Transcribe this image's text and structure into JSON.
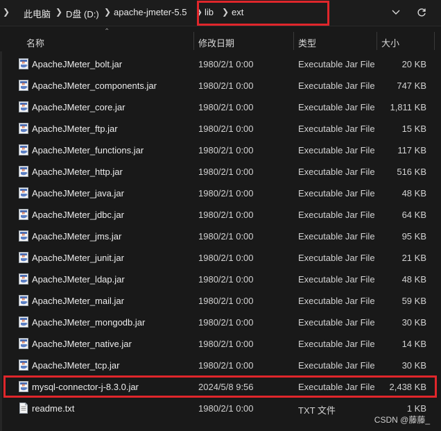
{
  "address": {
    "crumbs": [
      "此电脑",
      "D盘 (D:)",
      "apache-jmeter-5.5",
      "lib",
      "ext"
    ],
    "chevron_icon": "chevron-down-icon",
    "refresh_icon": "refresh-icon"
  },
  "columns": {
    "name": "名称",
    "date": "修改日期",
    "type": "类型",
    "size": "大小"
  },
  "files": [
    {
      "name": "ApacheJMeter_bolt.jar",
      "date": "1980/2/1 0:00",
      "type": "Executable Jar File",
      "size": "20 KB",
      "icon": "jar-file-icon"
    },
    {
      "name": "ApacheJMeter_components.jar",
      "date": "1980/2/1 0:00",
      "type": "Executable Jar File",
      "size": "747 KB",
      "icon": "jar-file-icon"
    },
    {
      "name": "ApacheJMeter_core.jar",
      "date": "1980/2/1 0:00",
      "type": "Executable Jar File",
      "size": "1,811 KB",
      "icon": "jar-file-icon"
    },
    {
      "name": "ApacheJMeter_ftp.jar",
      "date": "1980/2/1 0:00",
      "type": "Executable Jar File",
      "size": "15 KB",
      "icon": "jar-file-icon"
    },
    {
      "name": "ApacheJMeter_functions.jar",
      "date": "1980/2/1 0:00",
      "type": "Executable Jar File",
      "size": "117 KB",
      "icon": "jar-file-icon"
    },
    {
      "name": "ApacheJMeter_http.jar",
      "date": "1980/2/1 0:00",
      "type": "Executable Jar File",
      "size": "516 KB",
      "icon": "jar-file-icon"
    },
    {
      "name": "ApacheJMeter_java.jar",
      "date": "1980/2/1 0:00",
      "type": "Executable Jar File",
      "size": "48 KB",
      "icon": "jar-file-icon"
    },
    {
      "name": "ApacheJMeter_jdbc.jar",
      "date": "1980/2/1 0:00",
      "type": "Executable Jar File",
      "size": "64 KB",
      "icon": "jar-file-icon"
    },
    {
      "name": "ApacheJMeter_jms.jar",
      "date": "1980/2/1 0:00",
      "type": "Executable Jar File",
      "size": "95 KB",
      "icon": "jar-file-icon"
    },
    {
      "name": "ApacheJMeter_junit.jar",
      "date": "1980/2/1 0:00",
      "type": "Executable Jar File",
      "size": "21 KB",
      "icon": "jar-file-icon"
    },
    {
      "name": "ApacheJMeter_ldap.jar",
      "date": "1980/2/1 0:00",
      "type": "Executable Jar File",
      "size": "48 KB",
      "icon": "jar-file-icon"
    },
    {
      "name": "ApacheJMeter_mail.jar",
      "date": "1980/2/1 0:00",
      "type": "Executable Jar File",
      "size": "59 KB",
      "icon": "jar-file-icon"
    },
    {
      "name": "ApacheJMeter_mongodb.jar",
      "date": "1980/2/1 0:00",
      "type": "Executable Jar File",
      "size": "30 KB",
      "icon": "jar-file-icon"
    },
    {
      "name": "ApacheJMeter_native.jar",
      "date": "1980/2/1 0:00",
      "type": "Executable Jar File",
      "size": "14 KB",
      "icon": "jar-file-icon"
    },
    {
      "name": "ApacheJMeter_tcp.jar",
      "date": "1980/2/1 0:00",
      "type": "Executable Jar File",
      "size": "30 KB",
      "icon": "jar-file-icon"
    },
    {
      "name": "mysql-connector-j-8.3.0.jar",
      "date": "2024/5/8 9:56",
      "type": "Executable Jar File",
      "size": "2,438 KB",
      "icon": "jar-file-icon",
      "highlighted": true
    },
    {
      "name": "readme.txt",
      "date": "1980/2/1 0:00",
      "type": "TXT 文件",
      "size": "1 KB",
      "icon": "text-file-icon"
    }
  ],
  "watermark": "CSDN @藤藤_",
  "colors": {
    "background": "#191919",
    "highlight": "#e0262b",
    "text": "#ececec"
  }
}
